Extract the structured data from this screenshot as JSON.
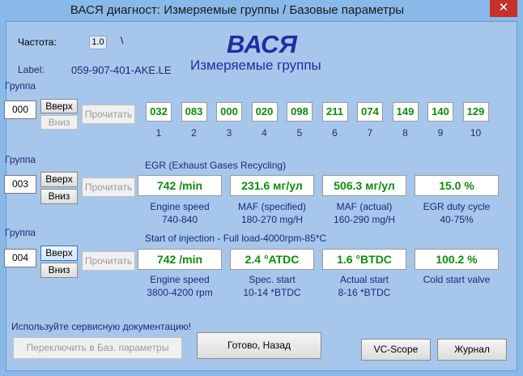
{
  "window": {
    "title": "ВАСЯ диагност: Измеряемые группы / Базовые параметры",
    "close_glyph": "✕"
  },
  "header": {
    "freq_label": "Частота:",
    "freq_value": "1.0",
    "freq_suffix": "\\",
    "label_label": "Label:",
    "label_value": "059-907-401-AKE.LE",
    "brand": "ВАСЯ",
    "subtitle": "Измеряемые группы"
  },
  "groups": [
    {
      "label": "Группа",
      "number": "000",
      "up": "Вверх",
      "down": "Вниз",
      "read": "Прочитать",
      "values": [
        "032",
        "083",
        "000",
        "020",
        "098",
        "211",
        "074",
        "149",
        "140",
        "129"
      ],
      "indices": [
        "1",
        "2",
        "3",
        "4",
        "5",
        "6",
        "7",
        "8",
        "9",
        "10"
      ]
    },
    {
      "label": "Группа",
      "number": "003",
      "up": "Вверх",
      "down": "Вниз",
      "read": "Прочитать",
      "heading": "EGR (Exhaust Gases Recycling)",
      "fields": [
        {
          "value": "742 /min",
          "name": "Engine speed",
          "range": "740-840"
        },
        {
          "value": "231.6 мг/ул",
          "name": "MAF (specified)",
          "range": "180-270 mg/H"
        },
        {
          "value": "506.3 мг/ул",
          "name": "MAF (actual)",
          "range": "160-290 mg/H"
        },
        {
          "value": "15.0 %",
          "name": "EGR duty cycle",
          "range": "40-75%"
        }
      ]
    },
    {
      "label": "Группа",
      "number": "004",
      "up": "Вверх",
      "down": "Вниз",
      "read": "Прочитать",
      "heading": "Start of injection - Full load-4000rpm-85*C",
      "fields": [
        {
          "value": "742 /min",
          "name": "Engine speed",
          "range": "3800-4200 rpm"
        },
        {
          "value": "2.4 °ATDC",
          "name": "Spec. start",
          "range": "10-14 *BTDC"
        },
        {
          "value": "1.6 °BTDC",
          "name": "Actual start",
          "range": "8-16 *BTDC"
        },
        {
          "value": "100.2 %",
          "name": "Cold start valve",
          "range": ""
        }
      ]
    }
  ],
  "footer": {
    "note": "Используйте сервисную документацию!",
    "switch_btn": "Переключить в Баз. параметры",
    "done_btn": "Готово, Назад",
    "scope_btn": "VC-Scope",
    "journal_btn": "Журнал"
  }
}
